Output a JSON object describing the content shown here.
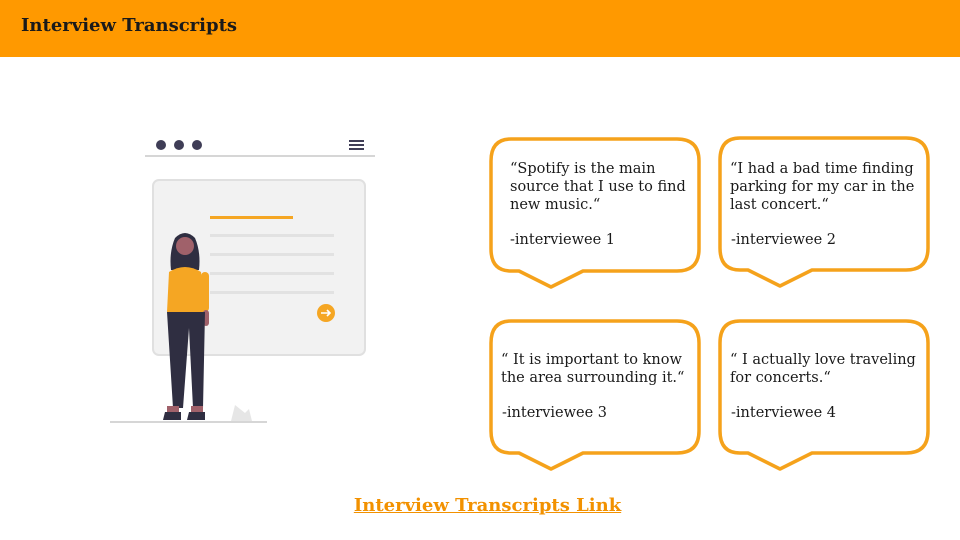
{
  "header": {
    "title": "Interview Transcripts"
  },
  "colors": {
    "accent": "#ff9900",
    "bubble_border": "#f5a21b",
    "figure_top": "#f5a623",
    "figure_pants": "#2f2e41"
  },
  "quotes": [
    {
      "text": "“Spotify is the main\nsource that I use to find\nnew music.“",
      "attribution": "-interviewee 1"
    },
    {
      "text": "“I had a bad time finding\nparking for my car in the\nlast concert.“",
      "attribution": "-interviewee 2"
    },
    {
      "text": "“ It is important to know\nthe area surrounding it.“",
      "attribution": "-interviewee 3"
    },
    {
      "text": "“  I actually love traveling\nfor concerts.“",
      "attribution": "-interviewee 4"
    }
  ],
  "footer": {
    "link_label": "Interview Transcripts Link"
  }
}
